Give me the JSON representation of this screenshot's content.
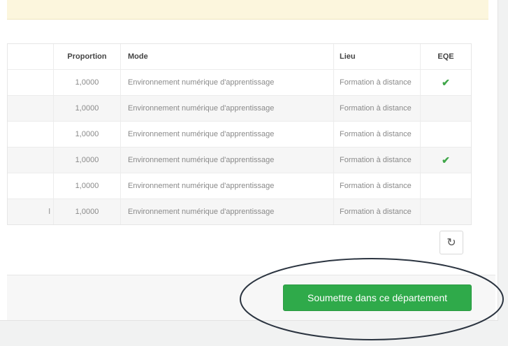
{
  "table": {
    "headers": {
      "proportion": "Proportion",
      "mode": "Mode",
      "lieu": "Lieu",
      "eqe": "EQE"
    },
    "rows": [
      {
        "lead": "",
        "proportion": "1,0000",
        "mode": "Environnement numérique d'apprentissage",
        "lieu": "Formation à distance",
        "eqe": "✔"
      },
      {
        "lead": "",
        "proportion": "1,0000",
        "mode": "Environnement numérique d'apprentissage",
        "lieu": "Formation à distance",
        "eqe": ""
      },
      {
        "lead": "",
        "proportion": "1,0000",
        "mode": "Environnement numérique d'apprentissage",
        "lieu": "Formation à distance",
        "eqe": ""
      },
      {
        "lead": "",
        "proportion": "1,0000",
        "mode": "Environnement numérique d'apprentissage",
        "lieu": "Formation à distance",
        "eqe": "✔"
      },
      {
        "lead": "",
        "proportion": "1,0000",
        "mode": "Environnement numérique d'apprentissage",
        "lieu": "Formation à distance",
        "eqe": ""
      },
      {
        "lead": "l",
        "proportion": "1,0000",
        "mode": "Environnement numérique d'apprentissage",
        "lieu": "Formation à distance",
        "eqe": ""
      }
    ]
  },
  "refresh": {
    "icon": "refresh-icon",
    "glyph": "↻"
  },
  "footer": {
    "submit_label": "Soumettre dans ce département"
  },
  "colors": {
    "accent": "#2faa4a",
    "check": "#3fa649",
    "alert_bg": "#fcf6dd"
  }
}
